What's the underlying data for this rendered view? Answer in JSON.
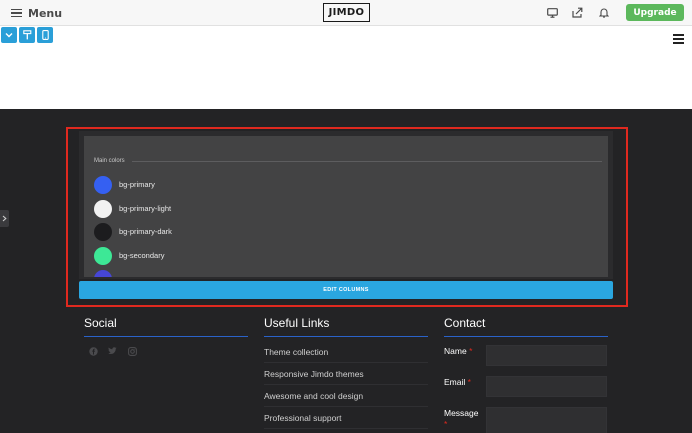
{
  "topbar": {
    "menu_label": "Menu",
    "logo_text": "JIMDO",
    "upgrade_label": "Upgrade",
    "icons": [
      "desktop-icon",
      "share-icon",
      "bell-icon"
    ]
  },
  "toolbar": {
    "icons": [
      "chevron-down-icon",
      "paint-roller-icon",
      "mobile-icon"
    ]
  },
  "colors": {
    "section_label": "Main colors",
    "items": [
      {
        "label": "bg-primary",
        "color": "#3560f2"
      },
      {
        "label": "bg-primary-light",
        "color": "#f2f2f2"
      },
      {
        "label": "bg-primary-dark",
        "color": "#1c1c1e"
      },
      {
        "label": "bg-secondary",
        "color": "#3de896"
      },
      {
        "label": "",
        "color": "#4646d6"
      }
    ],
    "edit_button_label": "EDIT COLUMNS"
  },
  "footer": {
    "social": {
      "title": "Social",
      "icons": [
        "facebook-icon",
        "twitter-icon",
        "instagram-icon"
      ]
    },
    "links": {
      "title": "Useful Links",
      "items": [
        "Theme collection",
        "Responsive Jimdo themes",
        "Awesome and cool design",
        "Professional support"
      ]
    },
    "contact": {
      "title": "Contact",
      "name_label": "Name",
      "email_label": "Email",
      "message_label": "Message",
      "required_mark": "*"
    }
  },
  "accent_colors": {
    "highlight": "#e0291f",
    "toolbar_blue": "#2a9fd8",
    "upgrade_green": "#5cb85c",
    "column_line": "#2a62c9"
  }
}
